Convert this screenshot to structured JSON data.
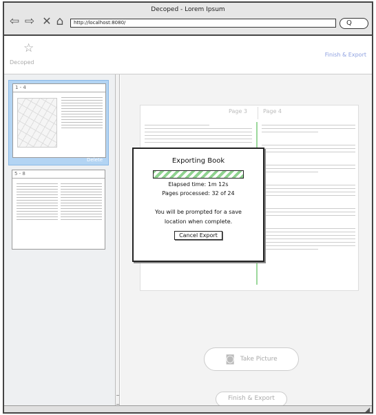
{
  "window": {
    "title": "Decoped - Lorem Ipsum"
  },
  "browser": {
    "url": "http://localhost:8080/",
    "search_label": "Q"
  },
  "app": {
    "logo_label": "Decoped",
    "finish_link": "Finish & Export"
  },
  "sidebar": {
    "thumbnails": [
      {
        "label": "1 - 4",
        "delete_label": "Delete",
        "selected": true
      },
      {
        "label": "5 - 8",
        "selected": false
      }
    ]
  },
  "spread": {
    "left_label": "Page 3",
    "right_label": "Page 4"
  },
  "actions": {
    "take_picture": "Take Picture",
    "finish_export": "Finish & Export"
  },
  "modal": {
    "title": "Exporting Book",
    "progress": 0.95,
    "elapsed": "Elapsed time: 1m 12s",
    "pages": "Pages processed: 32 of 24",
    "note_line1": "You will be prompted for a save",
    "note_line2": "location when complete.",
    "cancel": "Cancel Export"
  },
  "colors": {
    "selection": "#b3d4f3",
    "progress_stripe": "#8fd28f",
    "link": "#8c9fe0"
  }
}
